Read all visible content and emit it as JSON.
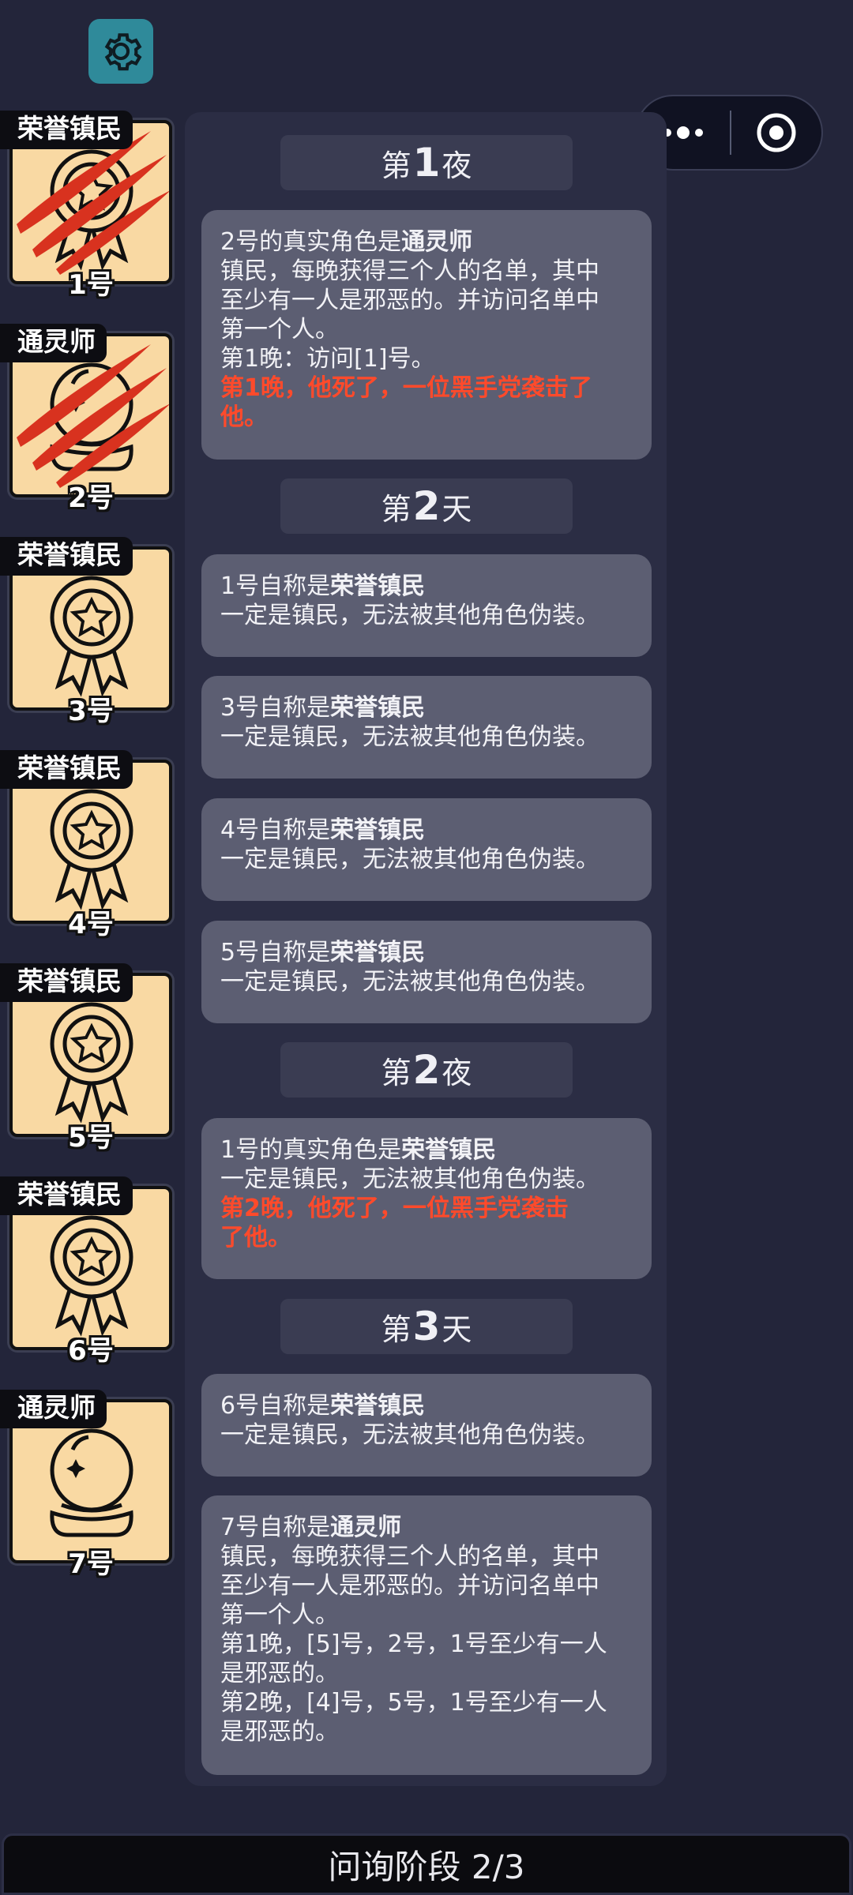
{
  "players": [
    {
      "role": "荣誉镇民",
      "number": "1号",
      "icon": "medal-icon",
      "dead": true
    },
    {
      "role": "通灵师",
      "number": "2号",
      "icon": "crystal-ball-icon",
      "dead": true
    },
    {
      "role": "荣誉镇民",
      "number": "3号",
      "icon": "medal-icon",
      "dead": false
    },
    {
      "role": "荣誉镇民",
      "number": "4号",
      "icon": "medal-icon",
      "dead": false
    },
    {
      "role": "荣誉镇民",
      "number": "5号",
      "icon": "medal-icon",
      "dead": false
    },
    {
      "role": "荣誉镇民",
      "number": "6号",
      "icon": "medal-icon",
      "dead": false
    },
    {
      "role": "通灵师",
      "number": "7号",
      "icon": "crystal-ball-icon",
      "dead": false
    }
  ],
  "log": {
    "h1": {
      "pre": "第",
      "num": "1",
      "post": "夜"
    },
    "m1": {
      "lead": "2号的真实角色是",
      "role": "通灵师",
      "lines": [
        "镇民，每晚获得三个人的名单，其中",
        "至少有一人是邪恶的。并访问名单中",
        "第一个人。",
        "第1晚：访问[1]号。"
      ],
      "death": [
        "第1晚，他死了，一位黑手党袭击了",
        "他。"
      ]
    },
    "h2": {
      "pre": "第",
      "num": "2",
      "post": "天"
    },
    "m2": {
      "lead": "1号自称是",
      "role": "荣誉镇民",
      "lines": [
        "一定是镇民，无法被其他角色伪装。"
      ]
    },
    "m3": {
      "lead": "3号自称是",
      "role": "荣誉镇民",
      "lines": [
        "一定是镇民，无法被其他角色伪装。"
      ]
    },
    "m4": {
      "lead": "4号自称是",
      "role": "荣誉镇民",
      "lines": [
        "一定是镇民，无法被其他角色伪装。"
      ]
    },
    "m5": {
      "lead": "5号自称是",
      "role": "荣誉镇民",
      "lines": [
        "一定是镇民，无法被其他角色伪装。"
      ]
    },
    "h3": {
      "pre": "第",
      "num": "2",
      "post": "夜"
    },
    "m6": {
      "lead": "1号的真实角色是",
      "role": "荣誉镇民",
      "lines": [
        "一定是镇民，无法被其他角色伪装。"
      ],
      "death": [
        "第2晚，他死了，一位黑手党袭击",
        "了他。"
      ]
    },
    "h4": {
      "pre": "第",
      "num": "3",
      "post": "天"
    },
    "m7": {
      "lead": "6号自称是",
      "role": "荣誉镇民",
      "lines": [
        "一定是镇民，无法被其他角色伪装。"
      ]
    },
    "m8": {
      "lead": "7号自称是",
      "role": "通灵师",
      "lines": [
        "镇民，每晚获得三个人的名单，其中",
        "至少有一人是邪恶的。并访问名单中",
        "第一个人。",
        "第1晚，[5]号，2号，1号至少有一人",
        "是邪恶的。",
        "第2晚，[4]号，5号，1号至少有一人",
        "是邪恶的。"
      ]
    }
  },
  "phase_bar": {
    "label": "问询阶段 2/3"
  },
  "colors": {
    "background": "#23253a",
    "card": "#f9d9a3",
    "death_text": "#ff4a2b",
    "message_bg": "#5c5e72",
    "settings": "#2f8a9a",
    "claw": "#d8321f"
  },
  "icons": {
    "settings": "gear-icon",
    "menu": "more-dots-icon",
    "close": "target-close-icon"
  }
}
